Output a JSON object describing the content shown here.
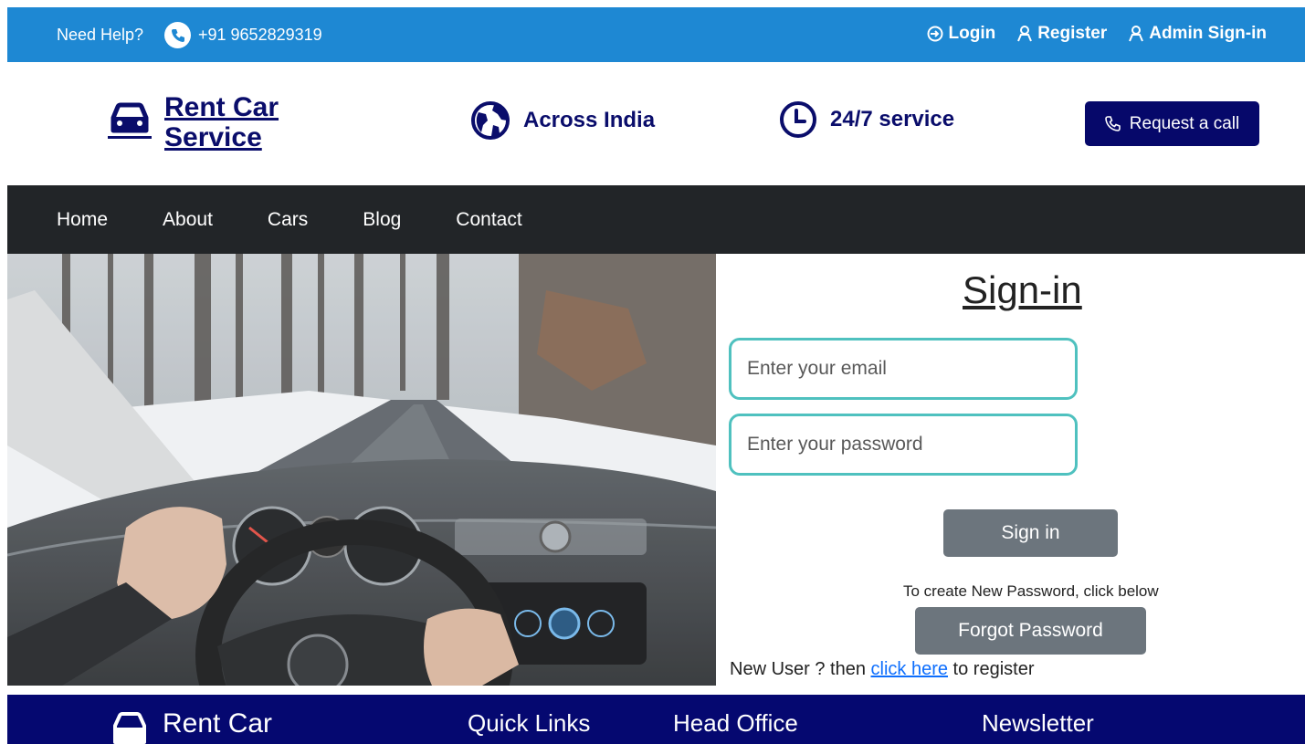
{
  "topbar": {
    "help_label": "Need Help?",
    "phone": "+91 9652829319",
    "links": [
      {
        "label": "Login",
        "icon": "login-icon"
      },
      {
        "label": "Register",
        "icon": "user-icon"
      },
      {
        "label": "Admin Sign-in",
        "icon": "user-icon"
      }
    ]
  },
  "brand": {
    "name_line1": "Rent Car",
    "name_line2": "Service",
    "features": [
      {
        "label": "Across India",
        "icon": "globe-icon"
      },
      {
        "label": "24/7 service",
        "icon": "clock-icon"
      }
    ],
    "request_call_label": "Request a call"
  },
  "nav": {
    "items": [
      "Home",
      "About",
      "Cars",
      "Blog",
      "Contact"
    ]
  },
  "signin": {
    "title": "Sign-in",
    "email_placeholder": "Enter your email",
    "password_placeholder": "Enter your password",
    "submit_label": "Sign in",
    "forgot_hint": "To create New Password, click below",
    "forgot_label": "Forgot Password",
    "new_user_prefix": "New User ? then ",
    "register_link": "click here",
    "new_user_suffix": " to register"
  },
  "footer": {
    "brand": "Rent Car",
    "headings": [
      "Quick Links",
      "Head Office",
      "Newsletter"
    ]
  },
  "colors": {
    "topbar": "#1e88d3",
    "brand_navy": "#0a0d6b",
    "navbar": "#222528",
    "input_border": "#4fc1bf",
    "button_gray": "#6c757d",
    "footer": "#050870"
  }
}
